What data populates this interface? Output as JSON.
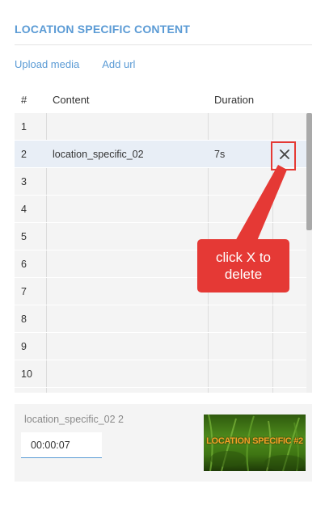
{
  "header": {
    "title": "LOCATION SPECIFIC CONTENT"
  },
  "toolbar": {
    "upload_label": "Upload media",
    "add_url_label": "Add url"
  },
  "table": {
    "columns": {
      "num": "#",
      "content": "Content",
      "duration": "Duration"
    },
    "rows": [
      {
        "num": "1",
        "content": "",
        "duration": ""
      },
      {
        "num": "2",
        "content": "location_specific_02",
        "duration": "7s",
        "selected": true
      },
      {
        "num": "3",
        "content": "",
        "duration": ""
      },
      {
        "num": "4",
        "content": "",
        "duration": ""
      },
      {
        "num": "5",
        "content": "",
        "duration": ""
      },
      {
        "num": "6",
        "content": "",
        "duration": ""
      },
      {
        "num": "7",
        "content": "",
        "duration": ""
      },
      {
        "num": "8",
        "content": "",
        "duration": ""
      },
      {
        "num": "9",
        "content": "",
        "duration": ""
      },
      {
        "num": "10",
        "content": "",
        "duration": ""
      }
    ],
    "delete_icon": "close-icon"
  },
  "callout": {
    "line1": "click X to",
    "line2": "delete",
    "color": "#e53935"
  },
  "preview": {
    "name": "location_specific_02 2",
    "duration_value": "00:00:07",
    "thumbnail_text": "LOCATION SPECIFIC #2"
  },
  "colors": {
    "accent": "#5b9bd5",
    "callout": "#e53935",
    "thumb_text": "#f2a227"
  }
}
